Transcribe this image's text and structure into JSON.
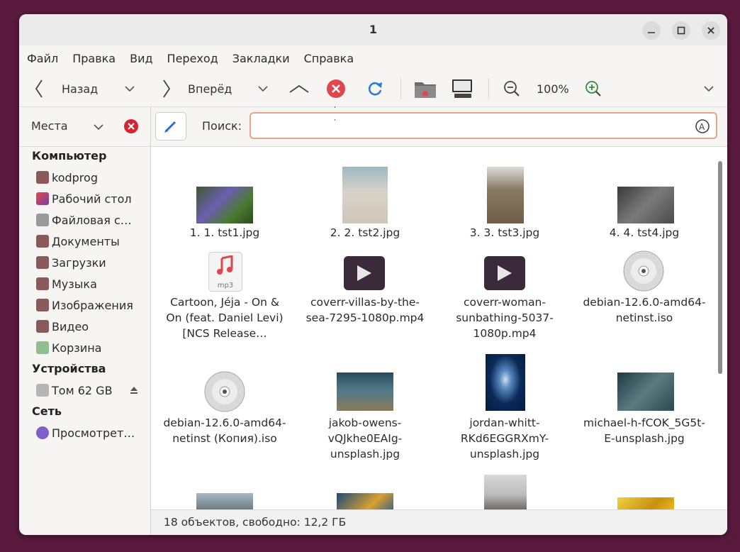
{
  "window": {
    "title": "1"
  },
  "menu": [
    "Файл",
    "Правка",
    "Вид",
    "Переход",
    "Закладки",
    "Справка"
  ],
  "toolbar": {
    "back_label": "Назад",
    "forward_label": "Вперёд",
    "zoom_value": "100%"
  },
  "location": {
    "places_label": "Места",
    "search_label": "Поиск:",
    "search_value": ""
  },
  "sidebar": {
    "sections": [
      {
        "title": "Компьютер",
        "items": [
          {
            "label": "kodprog",
            "icon": "home-folder-icon"
          },
          {
            "label": "Рабочий стол",
            "icon": "desktop-icon"
          },
          {
            "label": "Файловая с…",
            "icon": "filesystem-icon"
          },
          {
            "label": "Документы",
            "icon": "documents-folder-icon"
          },
          {
            "label": "Загрузки",
            "icon": "downloads-folder-icon"
          },
          {
            "label": "Музыка",
            "icon": "music-folder-icon"
          },
          {
            "label": "Изображения",
            "icon": "pictures-folder-icon"
          },
          {
            "label": "Видео",
            "icon": "videos-folder-icon"
          },
          {
            "label": "Корзина",
            "icon": "trash-icon"
          }
        ]
      },
      {
        "title": "Устройства",
        "items": [
          {
            "label": "Том 62 GB",
            "icon": "drive-icon"
          }
        ]
      },
      {
        "title": "Сеть",
        "items": [
          {
            "label": "Просмотрет…",
            "icon": "network-icon"
          }
        ]
      }
    ]
  },
  "files": [
    {
      "name": "1. 1. tst1.jpg",
      "kind": "image-flowers"
    },
    {
      "name": "2. 2. tst2.jpg",
      "kind": "image-sand"
    },
    {
      "name": "3. 3. tst3.jpg",
      "kind": "image-building"
    },
    {
      "name": "4. 4. tst4.jpg",
      "kind": "image-cat"
    },
    {
      "name": "Cartoon, Jéja - On & On (feat. Daniel Levi) [NCS Release…",
      "kind": "audio-mp3",
      "badge": "mp3"
    },
    {
      "name": "coverr-villas-by-the-sea-7295-1080p.mp4",
      "kind": "video"
    },
    {
      "name": "coverr-woman-sunbathing-5037-1080p.mp4",
      "kind": "video"
    },
    {
      "name": "debian-12.6.0-amd64-netinst.iso",
      "kind": "disc"
    },
    {
      "name": "debian-12.6.0-amd64-netinst (Копия).iso",
      "kind": "disc"
    },
    {
      "name": "jakob-owens-vQJkhe0EAIg-unsplash.jpg",
      "kind": "image-underwater"
    },
    {
      "name": "jordan-whitt-RKd6EGGRXmY-unsplash.jpg",
      "kind": "image-jellyfish"
    },
    {
      "name": "michael-h-fCOK_5G5t-E-unsplash.jpg",
      "kind": "image-reef"
    },
    {
      "name": "",
      "kind": "image-duck"
    },
    {
      "name": "",
      "kind": "image-coral"
    },
    {
      "name": "",
      "kind": "image-bird"
    },
    {
      "name": "",
      "kind": "image-yellow"
    }
  ],
  "status": {
    "text": "18 объектов, свободно: 12,2 ГБ"
  },
  "colors": {
    "accent_orange": "#e8a48a",
    "stop_red": "#e0464e",
    "reload_blue": "#2a7dd1"
  }
}
